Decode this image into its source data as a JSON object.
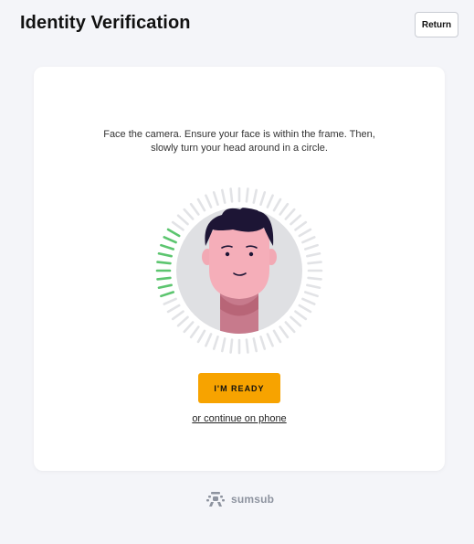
{
  "header": {
    "title": "Identity Verification",
    "return_label": "Return"
  },
  "card": {
    "instruction_line1": "Face the camera. Ensure your face is within the frame. Then,",
    "instruction_line2": "slowly turn your head around in a circle.",
    "progress": 0.15,
    "ready_label": "I'M READY",
    "phone_link_label": "or continue on phone"
  },
  "footer": {
    "brand_name": "sumsub",
    "brand_icon": "sumsub-logo-icon"
  },
  "colors": {
    "accent": "#f7a300",
    "progress_done": "#5cc56f",
    "progress_todo": "#e2e3e6",
    "background": "#f4f5f9"
  }
}
